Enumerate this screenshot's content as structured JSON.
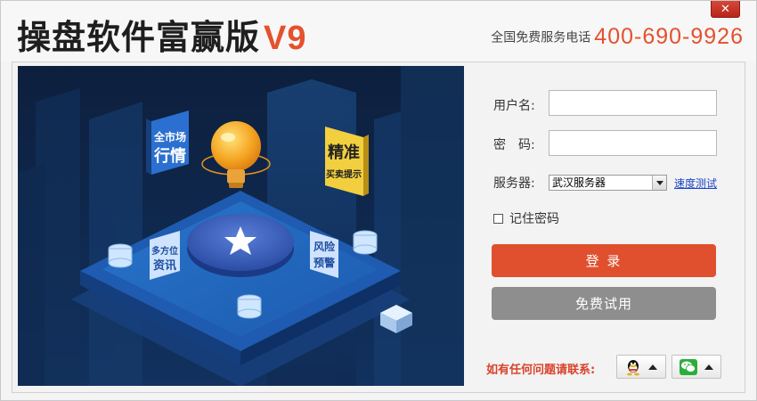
{
  "window": {
    "title_main": "操盘软件富赢版",
    "title_version": "V9",
    "hotline_label": "全国免费服务电话",
    "hotline_number": "400-690-9926",
    "close_glyph": "✕"
  },
  "banner": {
    "tags": {
      "market": [
        "全市场",
        "行情"
      ],
      "precise": [
        "精准",
        "买卖提示"
      ],
      "info": [
        "多方位",
        "资讯"
      ],
      "risk": [
        "风险",
        "预警"
      ]
    }
  },
  "form": {
    "username_label": "用户名:",
    "username_value": "",
    "password_label": "密　码:",
    "password_value": "",
    "server_label": "服务器:",
    "server_selected": "武汉服务器",
    "speed_test_label": "速度测试",
    "remember_label": "记住密码",
    "remember_checked": false,
    "login_label": "登 录",
    "trial_label": "免费试用",
    "contact_label": "如有任何问题请联系:"
  },
  "colors": {
    "accent": "#e0502e",
    "trial_button": "#8e8e8e",
    "link": "#1a45c9",
    "banner_bg": "#0f2547"
  },
  "icons": [
    "close-icon",
    "qq-icon",
    "wechat-icon",
    "dropdown-arrow-icon",
    "lightbulb-icon",
    "star-icon",
    "database-icon"
  ]
}
